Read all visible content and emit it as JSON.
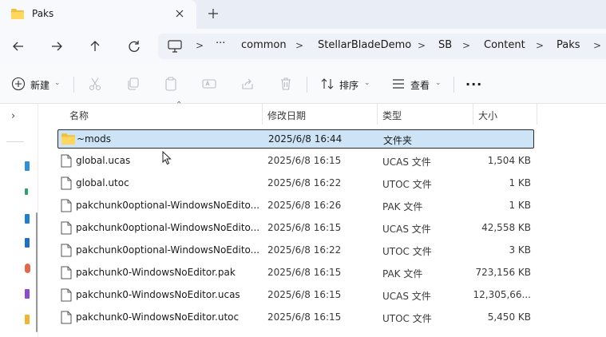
{
  "window": {
    "tab_title": "Paks",
    "tab_close_icon": "close-icon",
    "new_tab_icon": "plus-icon"
  },
  "navigation": {
    "back_icon": "arrow-left-icon",
    "forward_icon": "arrow-right-icon",
    "up_icon": "arrow-up-icon",
    "refresh_icon": "refresh-icon"
  },
  "address_bar": {
    "pc_icon": "monitor-icon",
    "overflow": "···",
    "crumbs": [
      "common",
      "StellarBladeDemo",
      "SB",
      "Content",
      "Paks"
    ],
    "separator": ">"
  },
  "commands": {
    "new_label": "新建",
    "sort_label": "排序",
    "view_label": "查看",
    "more_label": "···"
  },
  "columns": {
    "name": "名称",
    "date": "修改日期",
    "type": "类型",
    "size": "大小"
  },
  "files": [
    {
      "name": "~mods",
      "date": "2025/6/8 16:44",
      "type": "文件夹",
      "size": "",
      "icon": "folder-icon",
      "selected": true
    },
    {
      "name": "global.ucas",
      "date": "2025/6/8 16:15",
      "type": "UCAS 文件",
      "size": "1,504 KB",
      "icon": "file-icon",
      "selected": false
    },
    {
      "name": "global.utoc",
      "date": "2025/6/8 16:22",
      "type": "UTOC 文件",
      "size": "1 KB",
      "icon": "file-icon",
      "selected": false
    },
    {
      "name": "pakchunk0optional-WindowsNoEdito...",
      "date": "2025/6/8 16:26",
      "type": "PAK 文件",
      "size": "1 KB",
      "icon": "file-icon",
      "selected": false
    },
    {
      "name": "pakchunk0optional-WindowsNoEdito...",
      "date": "2025/6/8 16:15",
      "type": "UCAS 文件",
      "size": "42,558 KB",
      "icon": "file-icon",
      "selected": false
    },
    {
      "name": "pakchunk0optional-WindowsNoEdito...",
      "date": "2025/6/8 16:22",
      "type": "UTOC 文件",
      "size": "3 KB",
      "icon": "file-icon",
      "selected": false
    },
    {
      "name": "pakchunk0-WindowsNoEditor.pak",
      "date": "2025/6/8 16:15",
      "type": "PAK 文件",
      "size": "723,156 KB",
      "icon": "file-icon",
      "selected": false
    },
    {
      "name": "pakchunk0-WindowsNoEditor.ucas",
      "date": "2025/6/8 16:15",
      "type": "UCAS 文件",
      "size": "12,305,66...",
      "icon": "file-icon",
      "selected": false
    },
    {
      "name": "pakchunk0-WindowsNoEditor.utoc",
      "date": "2025/6/8 16:15",
      "type": "UTOC 文件",
      "size": "5,450 KB",
      "icon": "file-icon",
      "selected": false
    }
  ],
  "colors": {
    "folder": "#f3c03c",
    "selection_bg": "#cde4f7",
    "tab_strip": "#e9eef6"
  }
}
